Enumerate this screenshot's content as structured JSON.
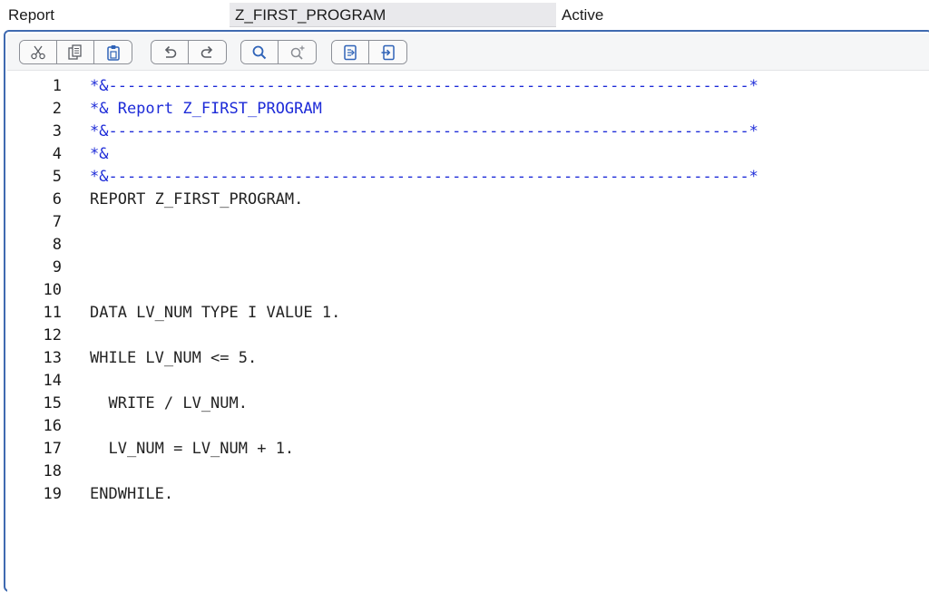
{
  "header": {
    "object_type": "Report",
    "object_name": "Z_FIRST_PROGRAM",
    "status": "Active"
  },
  "toolbar": {
    "groups": [
      [
        "scissors-icon",
        "copy-icon",
        "paste-icon"
      ],
      [
        "undo-icon",
        "redo-icon"
      ],
      [
        "search-icon",
        "search-plus-icon"
      ],
      [
        "export-icon",
        "import-icon"
      ]
    ]
  },
  "colors": {
    "frame_border": "#3f6ab0",
    "comment": "#1d2bd8",
    "code": "#232323"
  },
  "editor": {
    "lines": [
      {
        "num": "1",
        "text": "*&---------------------------------------------------------------------*",
        "comment": true
      },
      {
        "num": "2",
        "text": "*& Report Z_FIRST_PROGRAM",
        "comment": true
      },
      {
        "num": "3",
        "text": "*&---------------------------------------------------------------------*",
        "comment": true
      },
      {
        "num": "4",
        "text": "*&",
        "comment": true
      },
      {
        "num": "5",
        "text": "*&---------------------------------------------------------------------*",
        "comment": true
      },
      {
        "num": "6",
        "text": "REPORT Z_FIRST_PROGRAM.",
        "comment": false
      },
      {
        "num": "7",
        "text": "",
        "comment": false
      },
      {
        "num": "8",
        "text": "",
        "comment": false
      },
      {
        "num": "9",
        "text": "",
        "comment": false
      },
      {
        "num": "10",
        "text": "",
        "comment": false
      },
      {
        "num": "11",
        "text": "DATA LV_NUM TYPE I VALUE 1.",
        "comment": false
      },
      {
        "num": "12",
        "text": "",
        "comment": false
      },
      {
        "num": "13",
        "text": "WHILE LV_NUM <= 5.",
        "comment": false
      },
      {
        "num": "14",
        "text": "",
        "comment": false
      },
      {
        "num": "15",
        "text": "  WRITE / LV_NUM.",
        "comment": false
      },
      {
        "num": "16",
        "text": "",
        "comment": false
      },
      {
        "num": "17",
        "text": "  LV_NUM = LV_NUM + 1.",
        "comment": false
      },
      {
        "num": "18",
        "text": "",
        "comment": false
      },
      {
        "num": "19",
        "text": "ENDWHILE.",
        "comment": false
      }
    ]
  }
}
